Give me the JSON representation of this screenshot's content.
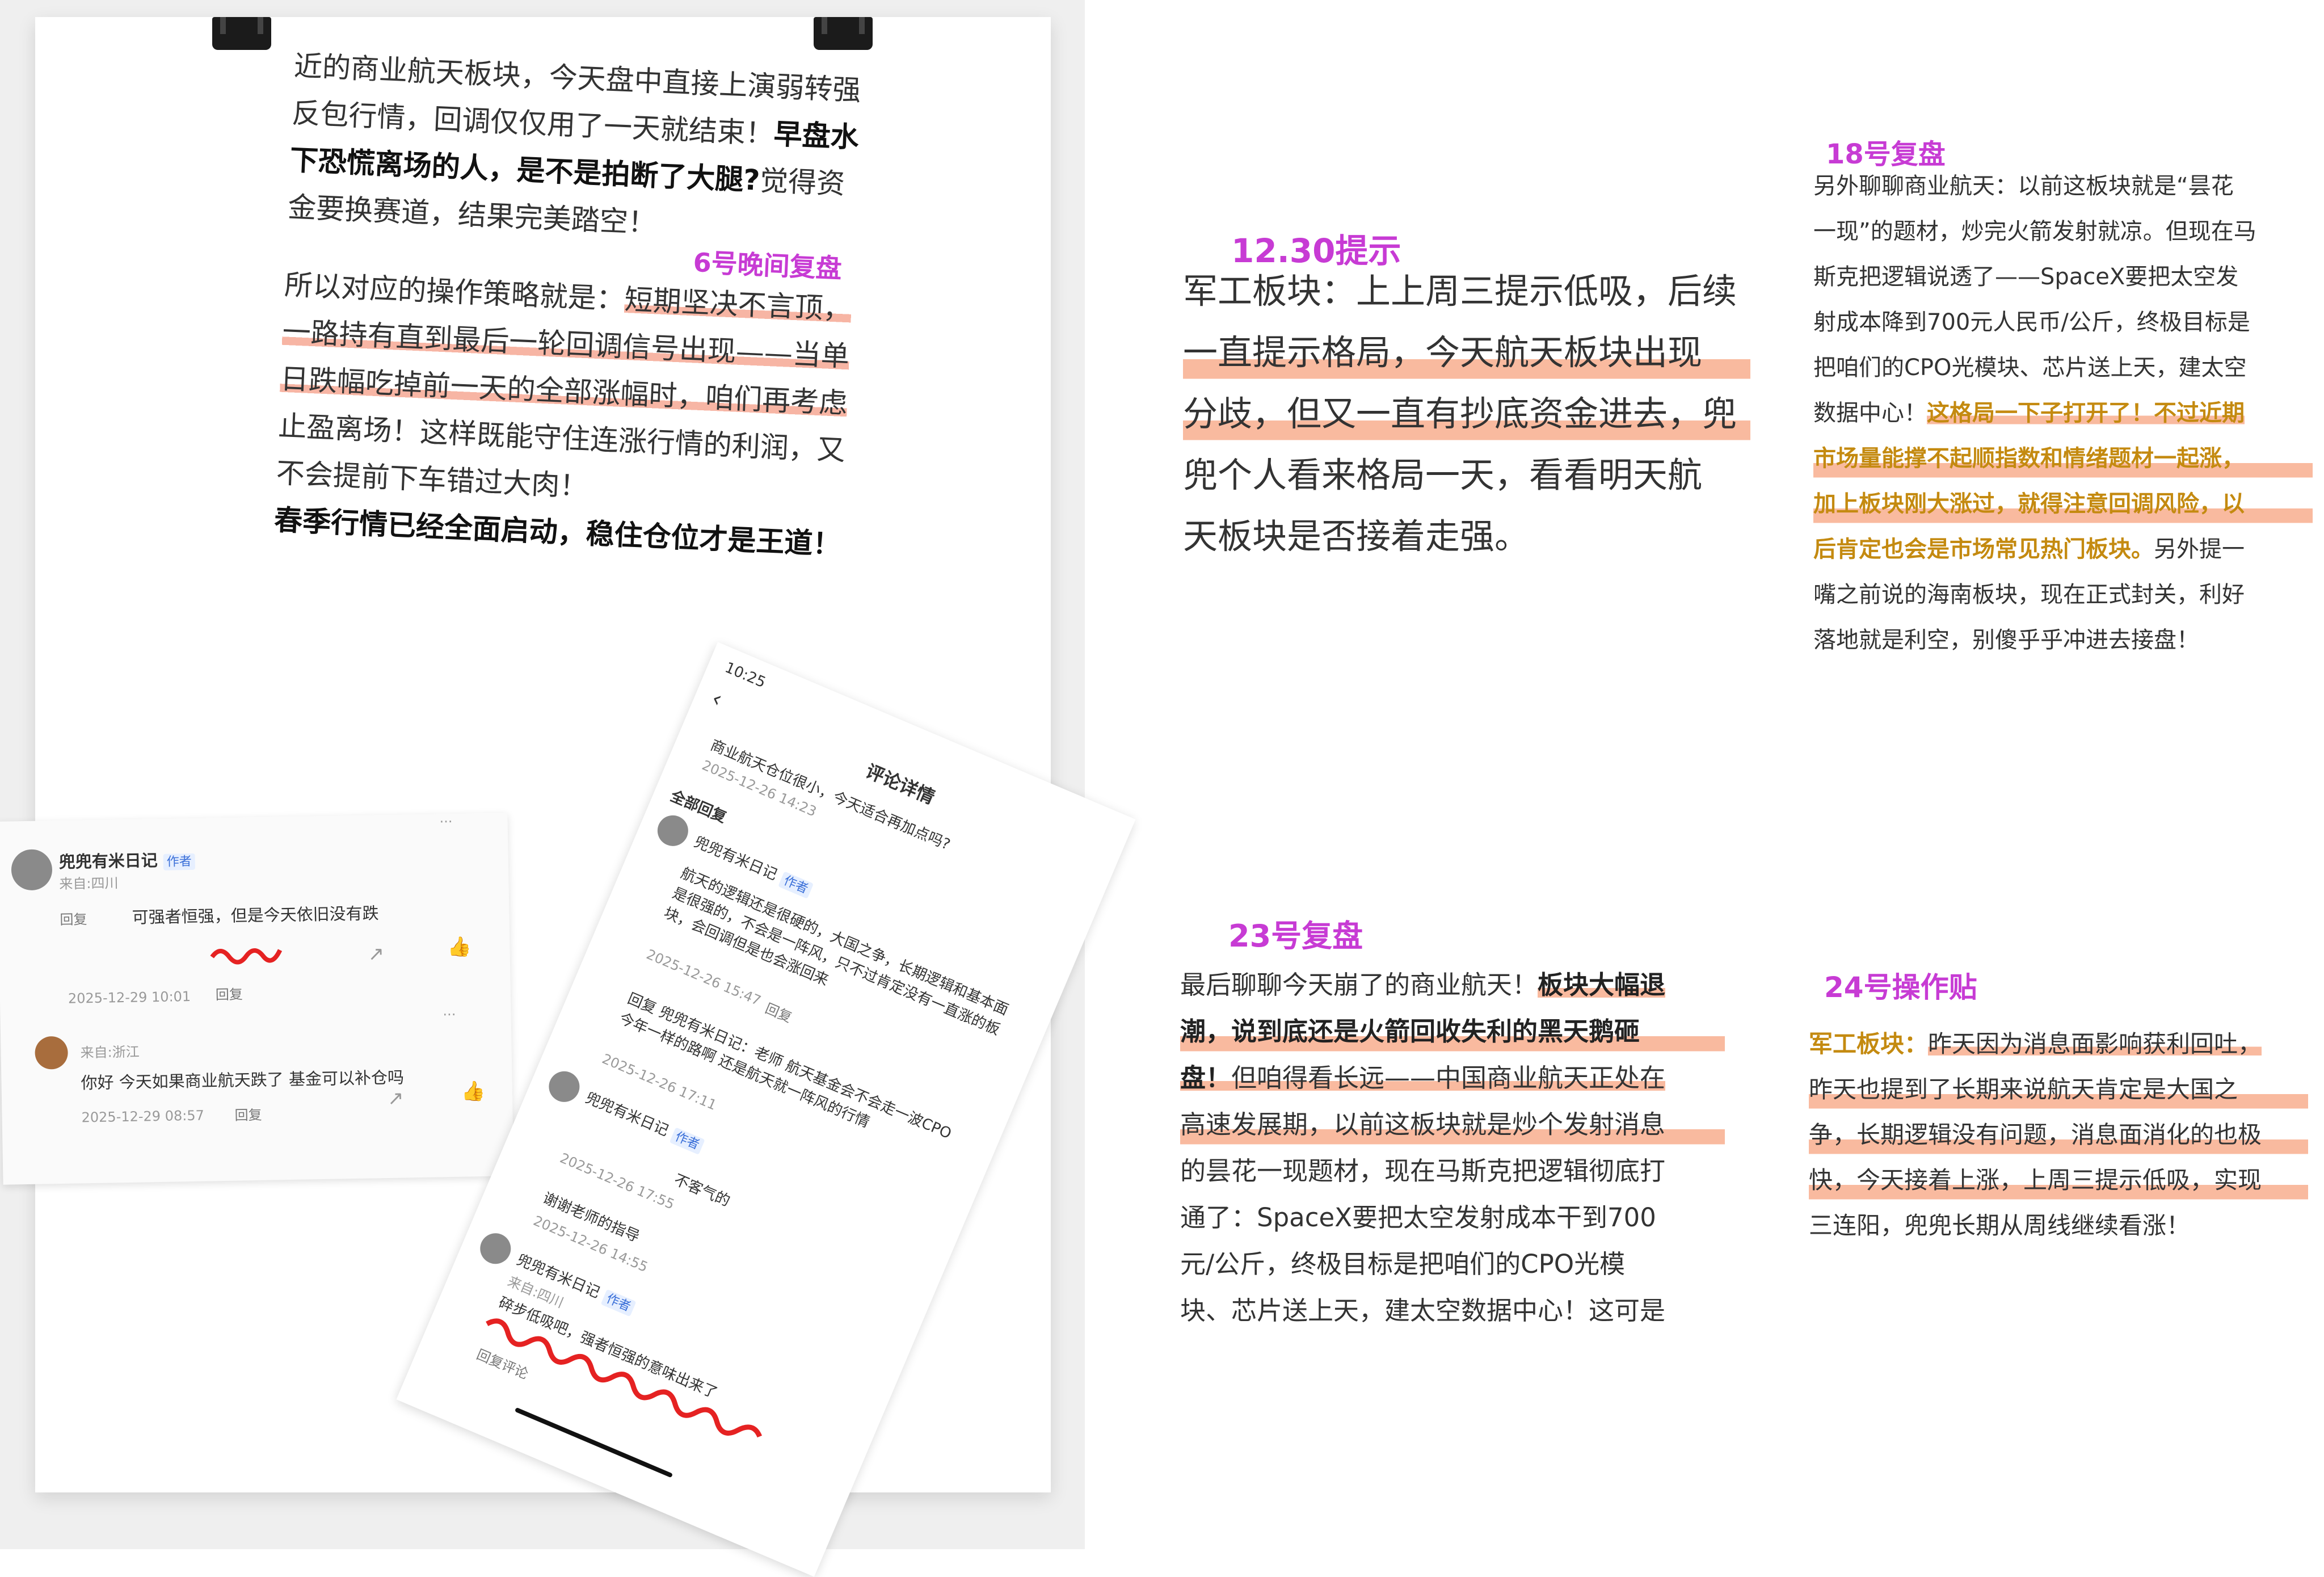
{
  "left_note": {
    "p1_a": "近的商业航天板块，今天盘中直接上演弱转强反包行情，回调仅仅用了一天就结束！",
    "p1_bold": "早盘水下恐慌离场的人，是不是拍断了大腿?",
    "p1_b": "觉得资金要换赛道，结果完美踏空！",
    "tag": "6号晚间复盘",
    "p2_a": "所以对应的操作策略就是：",
    "p2_hl": "短期坚决不言顶，一路持有直到最后一轮回调信号出现——当单日跌幅吃掉前一天的全部涨幅时，咱们再考虑",
    "p2_b": "止盈离场！这样既能守住连涨行情的利润，又不会提前下车错过大肉！",
    "p3_bold": "春季行情已经全面启动，稳住仓位才是王道！"
  },
  "comments_left": {
    "user": "兜兜有米日记",
    "author_badge": "作者",
    "location1": "来自:四川",
    "reply_prefix": "回复",
    "text1": "可强者恒强，但是今天依旧没有跌",
    "time1": "2025-12-29 10:01",
    "reply_label": "回复",
    "location2": "来自:浙江",
    "text2": "你好 今天如果商业航天跌了 基金可以补仓吗",
    "time2": "2025-12-29 08:57"
  },
  "comments_right": {
    "status_time": "10:25",
    "header": "评论详情",
    "post_text": "商业航天仓位很小，今天适合再加点吗?",
    "post_time": "2025-12-26 14:23",
    "all_replies": "全部回复",
    "user": "兜兜有米日记",
    "author_badge": "作者",
    "reply1": "航天的逻辑还是很硬的，大国之争，长期逻辑和基本面是很强的，不会是一阵风，只不过肯定没有一直涨的板块，会回调但是也会涨回来",
    "time1": "2025-12-26 15:47",
    "reply_label": "回复",
    "reply2": "回复 兜兜有米日记：老师 航天基金会不会走一波CPO今年一样的路啊 还是航天就一阵风的行情",
    "time2": "2025-12-26 17:11",
    "reply3": "不客气的",
    "time3": "2025-12-26 17:55",
    "reply4": "谢谢老师的指导",
    "time4": "2025-12-26 14:55",
    "location": "来自:四川",
    "reply5": "碎步低吸吧，强者恒强的意味出来了",
    "reply_comment": "回复评论"
  },
  "notes": {
    "n1230": {
      "tag": "12.30提示",
      "lines": [
        "军工板块：上上周三提示低吸，后续",
        "一直提示格局，今天航天板块出现",
        "分歧，但又一直有抄底资金进去，兜",
        "兜个人看来格局一天，看看明天航",
        "天板块是否接着走强。"
      ]
    },
    "n18": {
      "tag": "18号复盘",
      "lines": [
        "另外聊聊商业航天：以前这板块就是“昙花",
        "一现”的题材，炒完火箭发射就凉。但现在马",
        "斯克把逻辑说透了——SpaceX要把太空发",
        "射成本降到700元人民币/公斤，终极目标是",
        "把咱们的CPO光模块、芯片送上天，建太空",
        "数据中心！",
        "这格局一下子打开了！不过近期",
        "市场量能撑不起顺指数和情绪题材一起涨，",
        "加上板块刚大涨过，就得注意回调风险，以",
        "后肯定也会是市场常见热门板块。",
        "另外提一",
        "嘴之前说的海南板块，现在正式封关，利好",
        "落地就是利空，别傻乎乎冲进去接盘！"
      ]
    },
    "n23": {
      "tag": "23号复盘",
      "lines": [
        "最后聊聊今天崩了的商业航天！",
        "板块大幅退",
        "潮，说到底还是火箭回收失利的黑天鹅砸",
        "盘！",
        "但咱得看长远——中国商业航天正处在",
        "高速发展期，以前这板块就是炒个发射消息",
        "的昙花一现题材，现在马斯克把逻辑彻底打",
        "通了：SpaceX要把太空发射成本干到700",
        "元/公斤，终极目标是把咱们的CPO光模",
        "块、芯片送上天，建太空数据中心！这可是"
      ]
    },
    "n24": {
      "tag": "24号操作贴",
      "lines": [
        "军工板块：",
        "昨天因为消息面影响获利回吐，",
        "昨天也提到了长期来说航天肯定是大国之",
        "争，长期逻辑没有问题，消息面消化的也极",
        "快，今天接着上涨，上周三提示低吸，实现",
        "三连阳，兜兜长期从周线继续看涨！"
      ]
    }
  },
  "colors": {
    "tag_pink": "#c73bd4",
    "highlight_orange": "#f58c5f",
    "gold_text": "#c48a10"
  }
}
